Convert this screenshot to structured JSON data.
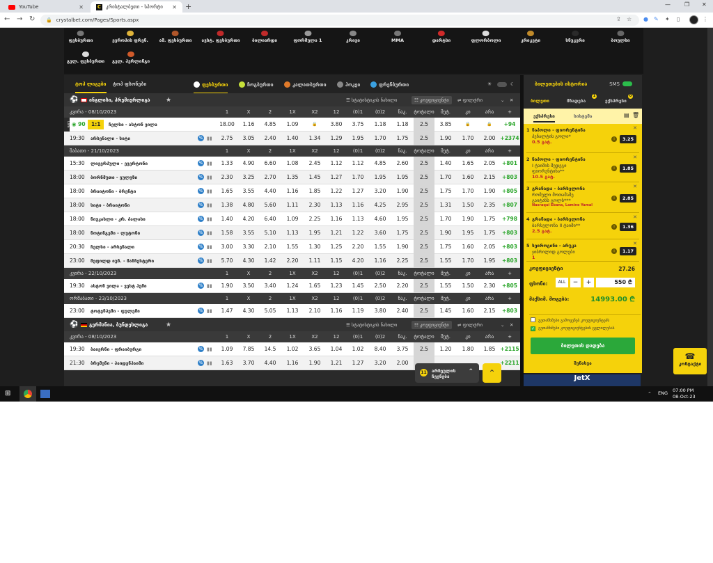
{
  "browser": {
    "tabs": [
      {
        "title": "YouTube",
        "icon": "youtube-icon"
      },
      {
        "title": "კრისტალბეთი - სპორტი",
        "icon": "crystalbet-icon"
      }
    ],
    "new_tab": "+",
    "url": "crystalbet.com/Pages/Sports.aspx",
    "window_controls": [
      "—",
      "❐",
      "✕"
    ]
  },
  "sports": {
    "row1": [
      "ფეხბურთი",
      "ევროპის ფრენ.",
      "ამ. ფეხბურთი",
      "ავსტ. ფეხბურთი",
      "ბილიარდი",
      "ფორმულა 1",
      "კრივი",
      "MMA",
      "დარტსი",
      "ფლორბოლი",
      "კრიკეტი",
      "სნუკერი",
      "ბოულსი"
    ],
    "row2": [
      "გელ. ფეხბურთი",
      "გელ. ჰერლინგი"
    ]
  },
  "filters": {
    "tabs": [
      "ტოპ ლიგები",
      "ტოპ ფსონები"
    ],
    "sports": [
      {
        "label": "ფეხბურთი",
        "color": "#ffffff"
      },
      {
        "label": "ჩოგბურთი",
        "color": "#c6e03a"
      },
      {
        "label": "კალათბურთი",
        "color": "#e07a2a"
      },
      {
        "label": "ჰოკეი",
        "color": "#888888"
      },
      {
        "label": "ფრენბურთი",
        "color": "#3aa0e0"
      }
    ]
  },
  "columns": [
    "1",
    "X",
    "2",
    "1X",
    "X2",
    "12",
    "(0)1",
    "(0)2",
    "ნაკ.",
    "ტოტალი",
    "მეტ.",
    "კი",
    "არა",
    "+"
  ],
  "leagues": [
    {
      "title": "ინგლისი, პრემიერლიგა",
      "tools": [
        "სტატისტიკის ნახილი",
        "კოეფიციენტი",
        "ფილტრი"
      ],
      "sections": [
        {
          "date": "კვირა - 08/10/2023",
          "matches": [
            {
              "time": "90",
              "live": true,
              "score": "1:1",
              "teams": "ჩელსი - ასტონ ვილა",
              "odds": [
                "18.00",
                "1.16",
                "4.85",
                "1.09",
                "🔒",
                "3.80",
                "3.75",
                "1.18",
                "1.18",
                "2.5",
                "3.85",
                "🔒",
                "🔒"
              ],
              "more": "+94"
            },
            {
              "time": "19:30",
              "teams": "არსენალი - სიტი",
              "odds": [
                "2.75",
                "3.05",
                "2.40",
                "1.40",
                "1.34",
                "1.29",
                "1.95",
                "1.70",
                "1.75",
                "2.5",
                "1.90",
                "1.70",
                "2.00"
              ],
              "more": "+2374"
            }
          ]
        },
        {
          "date": "შაბათი - 21/10/2023",
          "matches": [
            {
              "time": "15:30",
              "teams": "ლივერპული - ევერტონი",
              "odds": [
                "1.33",
                "4.90",
                "6.60",
                "1.08",
                "2.45",
                "1.12",
                "1.12",
                "4.85",
                "2.60",
                "2.5",
                "1.40",
                "1.65",
                "2.05"
              ],
              "more": "+801"
            },
            {
              "time": "18:00",
              "teams": "ბორნმუთი - ვულვზი",
              "odds": [
                "2.30",
                "3.25",
                "2.70",
                "1.35",
                "1.45",
                "1.27",
                "1.70",
                "1.95",
                "1.95",
                "2.5",
                "1.70",
                "1.60",
                "2.15"
              ],
              "more": "+803"
            },
            {
              "time": "18:00",
              "teams": "ბრაიტონი - ბრენტი",
              "odds": [
                "1.65",
                "3.55",
                "4.40",
                "1.16",
                "1.85",
                "1.22",
                "1.27",
                "3.20",
                "1.90",
                "2.5",
                "1.75",
                "1.70",
                "1.90"
              ],
              "more": "+805"
            },
            {
              "time": "18:00",
              "teams": "სიტი - ბრაიტონი",
              "odds": [
                "1.38",
                "4.80",
                "5.60",
                "1.11",
                "2.30",
                "1.13",
                "1.16",
                "4.25",
                "2.95",
                "2.5",
                "1.31",
                "1.50",
                "2.35"
              ],
              "more": "+807"
            },
            {
              "time": "18:00",
              "teams": "ნიუკასლი - კრ. პალასი",
              "odds": [
                "1.40",
                "4.20",
                "6.40",
                "1.09",
                "2.25",
                "1.16",
                "1.13",
                "4.60",
                "1.95",
                "2.5",
                "1.70",
                "1.90",
                "1.75"
              ],
              "more": "+798"
            },
            {
              "time": "18:00",
              "teams": "ნოტინგემი - ლუტონი",
              "odds": [
                "1.58",
                "3.55",
                "5.10",
                "1.13",
                "1.95",
                "1.21",
                "1.22",
                "3.60",
                "1.75",
                "2.5",
                "1.90",
                "1.95",
                "1.75"
              ],
              "more": "+803"
            },
            {
              "time": "20:30",
              "teams": "ჩელსი - არსენალი",
              "odds": [
                "3.00",
                "3.30",
                "2.10",
                "1.55",
                "1.30",
                "1.25",
                "2.20",
                "1.55",
                "1.90",
                "2.5",
                "1.75",
                "1.60",
                "2.05"
              ],
              "more": "+803"
            },
            {
              "time": "23:00",
              "teams": "შეფილდ იუნ. - მანჩესტერი",
              "odds": [
                "5.70",
                "4.30",
                "1.42",
                "2.20",
                "1.11",
                "1.15",
                "4.20",
                "1.16",
                "2.25",
                "2.5",
                "1.55",
                "1.70",
                "1.95"
              ],
              "more": "+803"
            }
          ]
        },
        {
          "date": "კვირა - 22/10/2023",
          "matches": [
            {
              "time": "19:30",
              "teams": "ასტონ ვილა - ვესტ ჰემი",
              "odds": [
                "1.90",
                "3.50",
                "3.40",
                "1.24",
                "1.65",
                "1.23",
                "1.45",
                "2.50",
                "2.20",
                "2.5",
                "1.55",
                "1.50",
                "2.30"
              ],
              "more": "+805"
            }
          ]
        },
        {
          "date": "ორშაბათი - 23/10/2023",
          "matches": [
            {
              "time": "23:00",
              "teams": "ტოტენჰემი - ფულემი",
              "odds": [
                "1.47",
                "4.30",
                "5.05",
                "1.13",
                "2.10",
                "1.16",
                "1.19",
                "3.80",
                "2.40",
                "2.5",
                "1.45",
                "1.60",
                "2.15"
              ],
              "more": "+803"
            }
          ]
        }
      ]
    },
    {
      "title": "გერმანია, ბუნდესლიგა",
      "tools": [
        "სტატისტიკის ნახილი",
        "კოეფიციენტი",
        "ფილტრი"
      ],
      "sections": [
        {
          "date": "კვირა - 08/10/2023",
          "matches": [
            {
              "time": "19:30",
              "teams": "ბაიერნი - ფრაიბურგი",
              "odds": [
                "1.09",
                "7.85",
                "14.5",
                "1.02",
                "3.65",
                "1.04",
                "1.02",
                "8.40",
                "3.75",
                "2.5",
                "1.20",
                "1.80",
                "1.85"
              ],
              "more": "+2115"
            },
            {
              "time": "21:30",
              "teams": "ბრემენი - ჰაიდენჰაიმი",
              "odds": [
                "1.63",
                "3.70",
                "4.40",
                "1.16",
                "1.90",
                "1.21",
                "1.27",
                "3.20",
                "2.00",
                "",
                "",
                "",
                ""
              ],
              "more": "+2211"
            }
          ]
        }
      ]
    }
  ],
  "betslip": {
    "title": "ბილეთების ისტორია",
    "sms": "SMS",
    "tabs": [
      {
        "label": "ბილეთი"
      },
      {
        "label": "მზადება",
        "badge": "1"
      },
      {
        "label": "ექსპრესი",
        "badge": "0"
      }
    ],
    "subtabs": [
      "ექსპრესი",
      "სისტემა"
    ],
    "bets": [
      {
        "num": "1",
        "match": "ნაპოლი - ფიორენტინა",
        "market": "პენალტის გოლი*",
        "extra": "0.5 გატ.",
        "odd": "3.25"
      },
      {
        "num": "2",
        "match": "ნაპოლი - ფიორენტინა",
        "market": "I ტაიმის შედეგი",
        "market2": "ფიორენტინა**",
        "extra": "10.5 გატ.",
        "odd": "1.85"
      },
      {
        "num": "3",
        "match": "გრანადა - ბარსელონა",
        "market": "რომელი მოთამაშე",
        "market2": "გაიტანს გოლს***",
        "extra": "Nasraqui Ebana, Lamine Yamal",
        "odd": "2.85"
      },
      {
        "num": "4",
        "match": "გრანადა - ბარსელონა",
        "market": "ბარსელონა II ტაიმი**",
        "extra": "2.5 გატ.",
        "odd": "1.36"
      },
      {
        "num": "5",
        "match": "სეიროგინი - არუკა",
        "market": "ჯიბრილიდ გოლები",
        "extra": "1",
        "odd": "1.17"
      }
    ],
    "total_label": "კოეფიციენტი",
    "total_odds": "27.26",
    "stake_label": "ფსონი:",
    "all_label": "ALL",
    "minus": "−",
    "plus": "+",
    "stake_value": "550",
    "currency": "₾",
    "win_label": "მაქსიმ. მოგება:",
    "win_value": "14993.00 ₾",
    "check1": "გეთანხმები გამოყენებ კოეფიციენტებს",
    "check2": "გეთანხმები კოეფიციენტების ცვლილებას",
    "place_button": "ბილეთის დადება",
    "save_label": "შენახვა"
  },
  "toast": {
    "count": "11",
    "text": "არჩეულის ჩვენება"
  },
  "call": {
    "label": "კონტაქტი"
  },
  "ad": {
    "text": "JetX"
  },
  "taskbar": {
    "lang": "ENG",
    "time": "07:00 PM",
    "date": "08-Oct-23"
  }
}
